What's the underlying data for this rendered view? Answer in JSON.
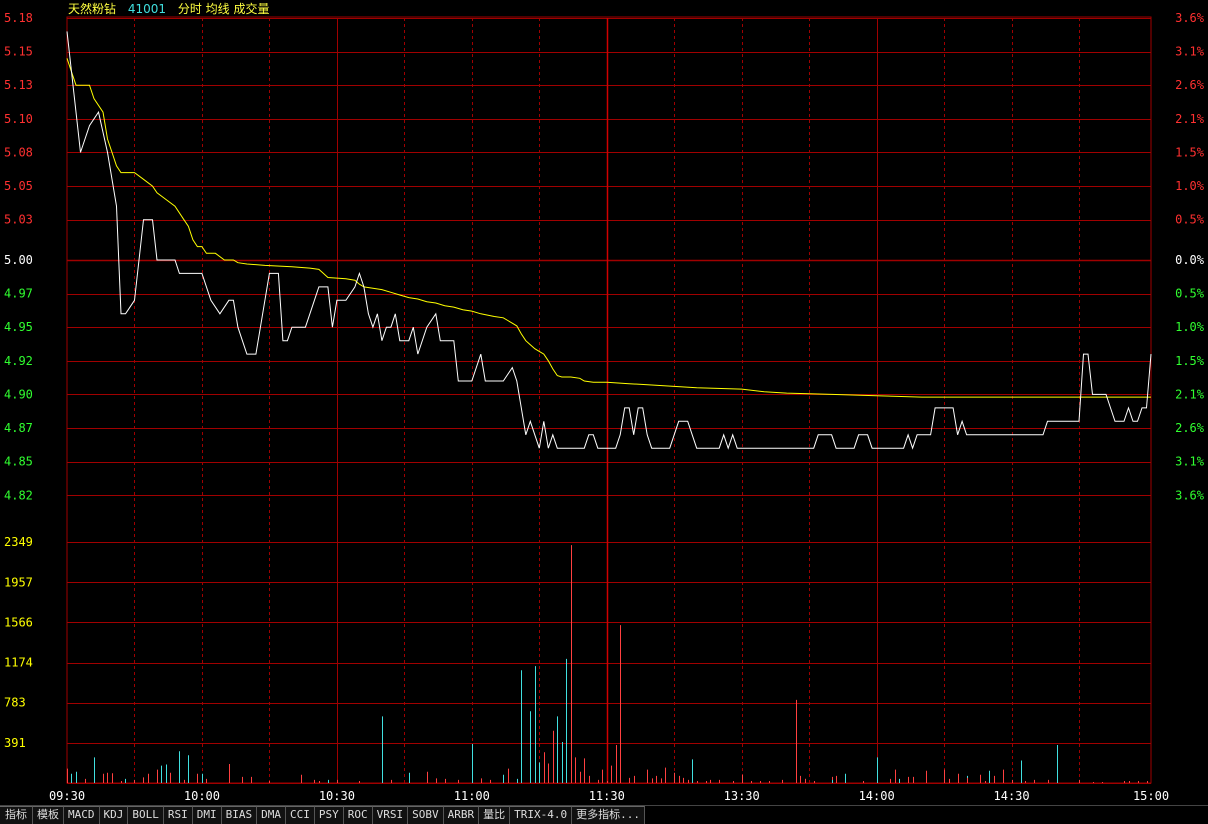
{
  "header": {
    "stock_name": "天然粉钻",
    "stock_code": "41001",
    "indicators": "分时 均线 成交量"
  },
  "colors": {
    "background": "#000000",
    "grid": "#a00000",
    "price_line": "#ffffff",
    "avg_line": "#ffff00",
    "up_label": "#ff3030",
    "down_label": "#30ff30",
    "flat_label": "#ffffff",
    "volume_label": "#ffff00",
    "vol_up": "#ff4040",
    "vol_down": "#40e0e0",
    "time_label": "#ffffff"
  },
  "chart_data": {
    "type": "line",
    "prev_close": 5.0,
    "price_axis": {
      "ylim": [
        4.82,
        5.18
      ],
      "ticks": [
        "5.18",
        "5.15",
        "5.13",
        "5.10",
        "5.08",
        "5.05",
        "5.03",
        "5.00",
        "4.97",
        "4.95",
        "4.92",
        "4.90",
        "4.87",
        "4.85",
        "4.82"
      ],
      "tick_values": [
        5.18,
        5.155,
        5.13,
        5.105,
        5.08,
        5.055,
        5.03,
        5.0,
        4.975,
        4.95,
        4.925,
        4.9,
        4.875,
        4.85,
        4.825
      ],
      "pct_ticks": [
        "3.6%",
        "3.1%",
        "2.6%",
        "2.1%",
        "1.5%",
        "1.0%",
        "0.5%",
        "0.0%",
        "0.5%",
        "1.0%",
        "1.5%",
        "2.1%",
        "2.6%",
        "3.1%",
        "3.6%"
      ]
    },
    "volume_axis": {
      "ylim": [
        0,
        2740
      ],
      "ticks": [
        "2349",
        "1957",
        "1566",
        "1174",
        "783",
        "391"
      ],
      "tick_values": [
        2349,
        1957,
        1566,
        1174,
        783,
        391
      ]
    },
    "time_labels": [
      "09:30",
      "10:00",
      "10:30",
      "11:00",
      "11:30",
      "13:30",
      "14:00",
      "14:30",
      "15:00"
    ],
    "price_series": [
      [
        0,
        5.17
      ],
      [
        1,
        5.14
      ],
      [
        3,
        5.08
      ],
      [
        5,
        5.1
      ],
      [
        7,
        5.11
      ],
      [
        9,
        5.08
      ],
      [
        11,
        5.04
      ],
      [
        12,
        4.96
      ],
      [
        13,
        4.96
      ],
      [
        15,
        4.97
      ],
      [
        17,
        5.03
      ],
      [
        19,
        5.03
      ],
      [
        20,
        5.0
      ],
      [
        22,
        5.0
      ],
      [
        24,
        5.0
      ],
      [
        25,
        4.99
      ],
      [
        28,
        4.99
      ],
      [
        30,
        4.99
      ],
      [
        32,
        4.97
      ],
      [
        34,
        4.96
      ],
      [
        36,
        4.97
      ],
      [
        37,
        4.97
      ],
      [
        38,
        4.95
      ],
      [
        40,
        4.93
      ],
      [
        42,
        4.93
      ],
      [
        44,
        4.97
      ],
      [
        45,
        4.99
      ],
      [
        47,
        4.99
      ],
      [
        48,
        4.94
      ],
      [
        49,
        4.94
      ],
      [
        50,
        4.95
      ],
      [
        53,
        4.95
      ],
      [
        55,
        4.97
      ],
      [
        56,
        4.98
      ],
      [
        58,
        4.98
      ],
      [
        59,
        4.95
      ],
      [
        60,
        4.97
      ],
      [
        62,
        4.97
      ],
      [
        64,
        4.98
      ],
      [
        65,
        4.99
      ],
      [
        66,
        4.98
      ],
      [
        67,
        4.96
      ],
      [
        68,
        4.95
      ],
      [
        69,
        4.96
      ],
      [
        70,
        4.94
      ],
      [
        71,
        4.95
      ],
      [
        72,
        4.95
      ],
      [
        73,
        4.96
      ],
      [
        74,
        4.94
      ],
      [
        76,
        4.94
      ],
      [
        77,
        4.95
      ],
      [
        78,
        4.93
      ],
      [
        80,
        4.95
      ],
      [
        82,
        4.96
      ],
      [
        83,
        4.94
      ],
      [
        84,
        4.94
      ],
      [
        86,
        4.94
      ],
      [
        87,
        4.91
      ],
      [
        90,
        4.91
      ],
      [
        92,
        4.93
      ],
      [
        93,
        4.91
      ],
      [
        97,
        4.91
      ],
      [
        99,
        4.92
      ],
      [
        100,
        4.91
      ],
      [
        101,
        4.89
      ],
      [
        102,
        4.87
      ],
      [
        103,
        4.88
      ],
      [
        104,
        4.87
      ],
      [
        105,
        4.86
      ],
      [
        106,
        4.88
      ],
      [
        107,
        4.86
      ],
      [
        108,
        4.87
      ],
      [
        109,
        4.86
      ],
      [
        115,
        4.86
      ],
      [
        116,
        4.87
      ],
      [
        117,
        4.87
      ],
      [
        118,
        4.86
      ],
      [
        122,
        4.86
      ],
      [
        123,
        4.87
      ],
      [
        124,
        4.89
      ],
      [
        125,
        4.89
      ],
      [
        126,
        4.87
      ],
      [
        127,
        4.89
      ],
      [
        128,
        4.89
      ],
      [
        129,
        4.87
      ],
      [
        130,
        4.86
      ],
      [
        134,
        4.86
      ],
      [
        135,
        4.87
      ],
      [
        136,
        4.88
      ],
      [
        138,
        4.88
      ],
      [
        139,
        4.87
      ],
      [
        140,
        4.86
      ],
      [
        145,
        4.86
      ],
      [
        146,
        4.87
      ],
      [
        147,
        4.86
      ],
      [
        148,
        4.87
      ],
      [
        149,
        4.86
      ],
      [
        166,
        4.86
      ],
      [
        167,
        4.87
      ],
      [
        170,
        4.87
      ],
      [
        171,
        4.86
      ],
      [
        175,
        4.86
      ],
      [
        176,
        4.87
      ],
      [
        178,
        4.87
      ],
      [
        179,
        4.86
      ],
      [
        186,
        4.86
      ],
      [
        187,
        4.87
      ],
      [
        188,
        4.86
      ],
      [
        189,
        4.87
      ],
      [
        192,
        4.87
      ],
      [
        193,
        4.89
      ],
      [
        197,
        4.89
      ],
      [
        198,
        4.87
      ],
      [
        199,
        4.88
      ],
      [
        200,
        4.87
      ],
      [
        217,
        4.87
      ],
      [
        218,
        4.88
      ],
      [
        225,
        4.88
      ],
      [
        226,
        4.93
      ],
      [
        227,
        4.93
      ],
      [
        228,
        4.9
      ],
      [
        231,
        4.9
      ],
      [
        232,
        4.89
      ],
      [
        233,
        4.88
      ],
      [
        235,
        4.88
      ],
      [
        236,
        4.89
      ],
      [
        237,
        4.88
      ],
      [
        238,
        4.88
      ],
      [
        239,
        4.89
      ],
      [
        240,
        4.89
      ],
      [
        241,
        4.93
      ]
    ],
    "avg_series": [
      [
        0,
        5.15
      ],
      [
        1,
        5.14
      ],
      [
        2,
        5.13
      ],
      [
        3,
        5.13
      ],
      [
        5,
        5.13
      ],
      [
        6,
        5.12
      ],
      [
        8,
        5.11
      ],
      [
        9,
        5.09
      ],
      [
        10,
        5.08
      ],
      [
        11,
        5.07
      ],
      [
        12,
        5.065
      ],
      [
        15,
        5.065
      ],
      [
        17,
        5.06
      ],
      [
        19,
        5.055
      ],
      [
        20,
        5.05
      ],
      [
        22,
        5.045
      ],
      [
        24,
        5.04
      ],
      [
        26,
        5.03
      ],
      [
        27,
        5.025
      ],
      [
        28,
        5.015
      ],
      [
        29,
        5.01
      ],
      [
        30,
        5.01
      ],
      [
        31,
        5.005
      ],
      [
        33,
        5.005
      ],
      [
        35,
        5.0
      ],
      [
        37,
        5.0
      ],
      [
        38,
        4.998
      ],
      [
        40,
        4.997
      ],
      [
        44,
        4.996
      ],
      [
        50,
        4.995
      ],
      [
        54,
        4.994
      ],
      [
        56,
        4.993
      ],
      [
        57,
        4.99
      ],
      [
        58,
        4.987
      ],
      [
        62,
        4.986
      ],
      [
        64,
        4.985
      ],
      [
        65,
        4.982
      ],
      [
        66,
        4.98
      ],
      [
        68,
        4.979
      ],
      [
        70,
        4.978
      ],
      [
        72,
        4.976
      ],
      [
        74,
        4.974
      ],
      [
        76,
        4.972
      ],
      [
        78,
        4.971
      ],
      [
        80,
        4.969
      ],
      [
        82,
        4.968
      ],
      [
        84,
        4.966
      ],
      [
        86,
        4.965
      ],
      [
        88,
        4.963
      ],
      [
        90,
        4.962
      ],
      [
        92,
        4.96
      ],
      [
        95,
        4.958
      ],
      [
        97,
        4.957
      ],
      [
        98,
        4.955
      ],
      [
        99,
        4.953
      ],
      [
        100,
        4.951
      ],
      [
        101,
        4.945
      ],
      [
        102,
        4.94
      ],
      [
        103,
        4.937
      ],
      [
        104,
        4.934
      ],
      [
        105,
        4.932
      ],
      [
        106,
        4.93
      ],
      [
        107,
        4.925
      ],
      [
        108,
        4.919
      ],
      [
        109,
        4.914
      ],
      [
        110,
        4.913
      ],
      [
        112,
        4.913
      ],
      [
        114,
        4.912
      ],
      [
        115,
        4.91
      ],
      [
        117,
        4.909
      ],
      [
        120,
        4.909
      ],
      [
        125,
        4.908
      ],
      [
        130,
        4.907
      ],
      [
        135,
        4.906
      ],
      [
        140,
        4.905
      ],
      [
        150,
        4.904
      ],
      [
        155,
        4.902
      ],
      [
        160,
        4.901
      ],
      [
        170,
        4.9
      ],
      [
        180,
        4.899
      ],
      [
        190,
        4.898
      ],
      [
        200,
        4.898
      ],
      [
        220,
        4.898
      ],
      [
        230,
        4.898
      ],
      [
        241,
        4.898
      ]
    ],
    "volume_series": [
      [
        0,
        140,
        "u"
      ],
      [
        1,
        90,
        "d"
      ],
      [
        2,
        110,
        "d"
      ],
      [
        4,
        40,
        "u"
      ],
      [
        6,
        250,
        "d"
      ],
      [
        8,
        90,
        "u"
      ],
      [
        9,
        100,
        "u"
      ],
      [
        10,
        95,
        "u"
      ],
      [
        12,
        20,
        "u"
      ],
      [
        13,
        40,
        "d"
      ],
      [
        15,
        30,
        "u"
      ],
      [
        17,
        55,
        "u"
      ],
      [
        18,
        90,
        "u"
      ],
      [
        20,
        130,
        "u"
      ],
      [
        21,
        170,
        "d"
      ],
      [
        22,
        180,
        "d"
      ],
      [
        23,
        100,
        "u"
      ],
      [
        25,
        310,
        "d"
      ],
      [
        26,
        30,
        "u"
      ],
      [
        27,
        270,
        "d"
      ],
      [
        29,
        90,
        "u"
      ],
      [
        30,
        90,
        "d"
      ],
      [
        31,
        40,
        "u"
      ],
      [
        36,
        185,
        "u"
      ],
      [
        39,
        60,
        "u"
      ],
      [
        41,
        60,
        "u"
      ],
      [
        45,
        20,
        "u"
      ],
      [
        52,
        80,
        "u"
      ],
      [
        55,
        30,
        "u"
      ],
      [
        56,
        20,
        "u"
      ],
      [
        58,
        30,
        "d"
      ],
      [
        60,
        30,
        "u"
      ],
      [
        65,
        20,
        "u"
      ],
      [
        70,
        650,
        "d"
      ],
      [
        72,
        30,
        "u"
      ],
      [
        76,
        100,
        "d"
      ],
      [
        80,
        110,
        "u"
      ],
      [
        82,
        45,
        "u"
      ],
      [
        84,
        40,
        "u"
      ],
      [
        87,
        30,
        "u"
      ],
      [
        90,
        380,
        "d"
      ],
      [
        92,
        45,
        "u"
      ],
      [
        94,
        30,
        "u"
      ],
      [
        97,
        80,
        "d"
      ],
      [
        98,
        140,
        "u"
      ],
      [
        100,
        40,
        "d"
      ],
      [
        105,
        200,
        "d"
      ],
      [
        109,
        30,
        "u"
      ],
      [
        111,
        50,
        "u"
      ],
      [
        115,
        50,
        "u"
      ],
      [
        118,
        30,
        "u"
      ],
      [
        120,
        20,
        "u"
      ],
      [
        123,
        100,
        "u"
      ],
      [
        125,
        50,
        "u"
      ],
      [
        126,
        70,
        "u"
      ],
      [
        129,
        30,
        "u"
      ],
      [
        130,
        45,
        "u"
      ],
      [
        132,
        45,
        "u"
      ],
      [
        135,
        100,
        "u"
      ],
      [
        136,
        70,
        "u"
      ],
      [
        138,
        30,
        "u"
      ],
      [
        140,
        20,
        "u"
      ],
      [
        145,
        30,
        "u"
      ],
      [
        148,
        20,
        "u"
      ],
      [
        152,
        20,
        "u"
      ],
      [
        156,
        20,
        "u"
      ],
      [
        159,
        30,
        "u"
      ],
      [
        164,
        40,
        "u"
      ],
      [
        170,
        60,
        "u"
      ],
      [
        173,
        90,
        "d"
      ],
      [
        177,
        20,
        "u"
      ],
      [
        180,
        250,
        "d"
      ],
      [
        183,
        40,
        "u"
      ],
      [
        184,
        130,
        "u"
      ],
      [
        185,
        40,
        "d"
      ],
      [
        188,
        60,
        "u"
      ],
      [
        191,
        120,
        "u"
      ],
      [
        195,
        130,
        "u"
      ],
      [
        198,
        90,
        "u"
      ],
      [
        200,
        70,
        "d"
      ],
      [
        203,
        80,
        "u"
      ],
      [
        205,
        120,
        "d"
      ],
      [
        206,
        70,
        "u"
      ],
      [
        208,
        130,
        "u"
      ],
      [
        210,
        30,
        "u"
      ],
      [
        212,
        220,
        "d"
      ],
      [
        215,
        30,
        "u"
      ],
      [
        220,
        370,
        "d"
      ],
      [
        225,
        30,
        "u"
      ],
      [
        228,
        10,
        "u"
      ],
      [
        230,
        10,
        "u"
      ],
      [
        235,
        20,
        "u"
      ],
      [
        240,
        20,
        "u"
      ],
      [
        108,
        160,
        "u"
      ],
      [
        107,
        190,
        "u"
      ],
      [
        106,
        300,
        "u"
      ],
      [
        104,
        1140,
        "d"
      ],
      [
        103,
        700,
        "d"
      ],
      [
        101,
        1100,
        "d"
      ],
      [
        111,
        1210,
        "d"
      ],
      [
        112,
        2320,
        "u"
      ],
      [
        108,
        510,
        "u"
      ],
      [
        109,
        650,
        "d"
      ],
      [
        110,
        400,
        "d"
      ],
      [
        113,
        250,
        "u"
      ],
      [
        114,
        110,
        "u"
      ],
      [
        115,
        240,
        "u"
      ],
      [
        116,
        70,
        "u"
      ],
      [
        119,
        130,
        "u"
      ],
      [
        121,
        170,
        "u"
      ],
      [
        122,
        370,
        "u"
      ],
      [
        123,
        1540,
        "u"
      ],
      [
        129,
        130,
        "u"
      ],
      [
        131,
        70,
        "u"
      ],
      [
        133,
        150,
        "u"
      ],
      [
        137,
        50,
        "u"
      ],
      [
        139,
        230,
        "d"
      ],
      [
        142,
        20,
        "u"
      ],
      [
        143,
        30,
        "u"
      ],
      [
        154,
        20,
        "u"
      ],
      [
        166,
        20,
        "u"
      ],
      [
        187,
        60,
        "u"
      ],
      [
        200,
        50,
        "u"
      ],
      [
        204,
        20,
        "u"
      ],
      [
        208,
        20,
        "u"
      ],
      [
        170,
        30,
        "d"
      ],
      [
        171,
        70,
        "u"
      ],
      [
        196,
        40,
        "u"
      ],
      [
        203,
        40,
        "u"
      ],
      [
        213,
        20,
        "u"
      ],
      [
        218,
        30,
        "u"
      ],
      [
        236,
        20,
        "u"
      ],
      [
        238,
        20,
        "u"
      ],
      [
        162,
        810,
        "u"
      ],
      [
        163,
        70,
        "u"
      ],
      [
        164,
        40,
        "u"
      ],
      [
        150,
        80,
        "u"
      ]
    ]
  },
  "tabs": [
    "指标",
    "模板",
    "MACD",
    "KDJ",
    "BOLL",
    "RSI",
    "DMI",
    "BIAS",
    "DMA",
    "CCI",
    "PSY",
    "ROC",
    "VRSI",
    "SOBV",
    "ARBR",
    "量比",
    "TRIX-4.0",
    "更多指标..."
  ]
}
